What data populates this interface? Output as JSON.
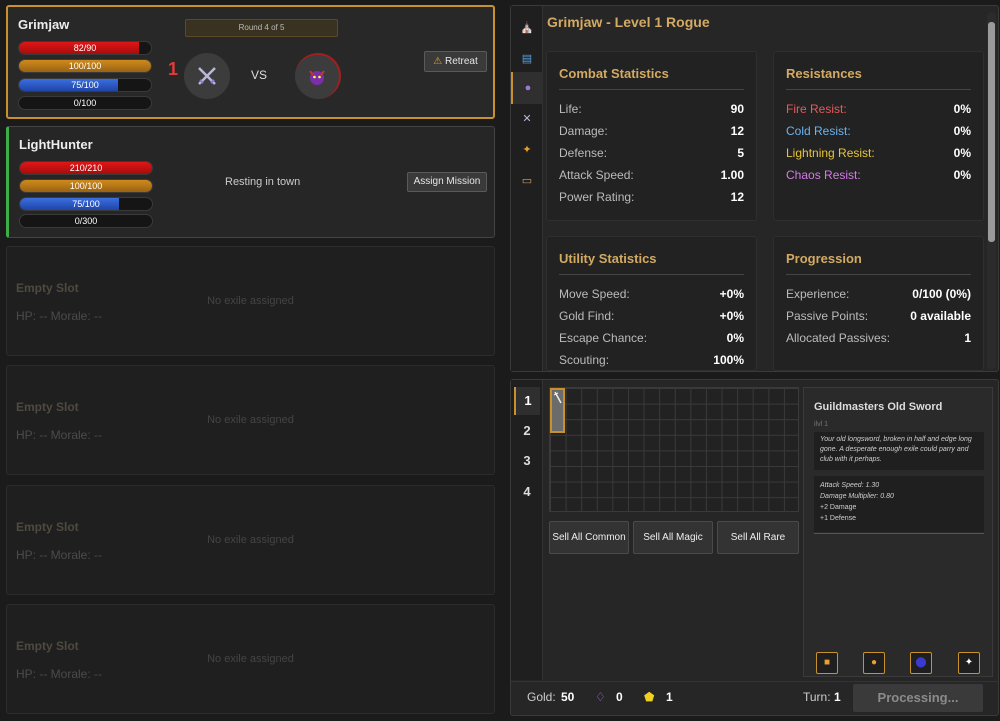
{
  "party": [
    {
      "name": "Grimjaw",
      "bars": {
        "life": "82/90",
        "morale": "100/100",
        "mana": "75/100",
        "xp": "0/100"
      },
      "fills": {
        "life": 0.91,
        "morale": 1.0,
        "mana": 0.75,
        "xp": 0.0
      },
      "round": "Round 4 of 5",
      "combo": "1",
      "vs": "VS",
      "action": "Retreat"
    },
    {
      "name": "LightHunter",
      "bars": {
        "life": "210/210",
        "morale": "100/100",
        "mana": "75/100",
        "xp": "0/300"
      },
      "fills": {
        "life": 1.0,
        "morale": 1.0,
        "mana": 0.75,
        "xp": 0.0
      },
      "status": "Resting in town",
      "action": "Assign Mission"
    }
  ],
  "empty_slots": [
    {
      "title": "Empty Slot",
      "hp": "HP: -- Morale: --",
      "msg": "No exile assigned"
    },
    {
      "title": "Empty Slot",
      "hp": "HP: -- Morale: --",
      "msg": "No exile assigned"
    },
    {
      "title": "Empty Slot",
      "hp": "HP: -- Morale: --",
      "msg": "No exile assigned"
    },
    {
      "title": "Empty Slot",
      "hp": "HP: -- Morale: --",
      "msg": "No exile assigned"
    }
  ],
  "character": {
    "title": "Grimjaw - Level 1 Rogue",
    "combat": {
      "heading": "Combat Statistics",
      "rows": [
        [
          "Life:",
          "90"
        ],
        [
          "Damage:",
          "12"
        ],
        [
          "Defense:",
          "5"
        ],
        [
          "Attack Speed:",
          "1.00"
        ],
        [
          "Power Rating:",
          "12"
        ]
      ]
    },
    "resist": {
      "heading": "Resistances",
      "rows": [
        [
          "Fire Resist:",
          "0%"
        ],
        [
          "Cold Resist:",
          "0%"
        ],
        [
          "Lightning Resist:",
          "0%"
        ],
        [
          "Chaos Resist:",
          "0%"
        ]
      ],
      "colors": [
        "#e85a5a",
        "#6bb2f0",
        "#e8c43a",
        "#d37ae8"
      ]
    },
    "utility": {
      "heading": "Utility Statistics",
      "rows": [
        [
          "Move Speed:",
          "+0%"
        ],
        [
          "Gold Find:",
          "+0%"
        ],
        [
          "Escape Chance:",
          "0%"
        ],
        [
          "Scouting:",
          "100%"
        ]
      ]
    },
    "progression": {
      "heading": "Progression",
      "rows": [
        [
          "Experience:",
          "0/100 (0%)"
        ],
        [
          "Passive Points:",
          "0 available"
        ],
        [
          "Allocated Passives:",
          "1"
        ]
      ]
    }
  },
  "tabs": [
    "town-icon",
    "book-icon",
    "character-icon",
    "swords-icon",
    "sparkle-icon",
    "scroll-icon"
  ],
  "inventory": {
    "pages": [
      "1",
      "2",
      "3",
      "4"
    ],
    "sell": [
      "Sell All Common",
      "Sell All Magic",
      "Sell All Rare"
    ],
    "item": {
      "name": "Guildmasters Old Sword",
      "level": "ilvl 1",
      "flavor": "Your old longsword, broken in half and edge long gone. A desperate enough exile could parry and club with it perhaps.",
      "attack_speed": "Attack Speed: 1.30",
      "damage_mult": "Damage Multiplier: 0.80",
      "mod1": "+2 Damage",
      "mod2": "+1 Defense"
    }
  },
  "footer": {
    "gold_label": "Gold:",
    "gold": "50",
    "crystal": "0",
    "gem": "1",
    "turn_label": "Turn:",
    "turn": "1",
    "processing": "Processing..."
  }
}
